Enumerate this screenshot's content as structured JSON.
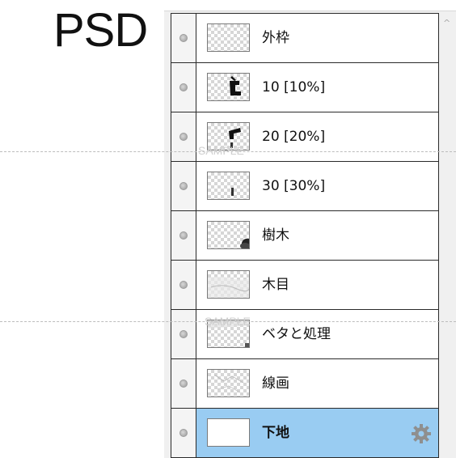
{
  "header": {
    "label": "PSD"
  },
  "watermark": {
    "text": "SAMPLE"
  },
  "colors": {
    "selected_row": "#99ccf2",
    "border": "#2a2a2a",
    "panel_bg": "#f0f0f0"
  },
  "layers": [
    {
      "name": "外枠",
      "visible_icon": "visibility-dot-icon",
      "thumb": "empty"
    },
    {
      "name": "10 [10%]",
      "visible_icon": "visibility-dot-icon",
      "thumb": "shape-10"
    },
    {
      "name": "20 [20%]",
      "visible_icon": "visibility-dot-icon",
      "thumb": "shape-20"
    },
    {
      "name": "30 [30%]",
      "visible_icon": "visibility-dot-icon",
      "thumb": "shape-30"
    },
    {
      "name": "樹木",
      "visible_icon": "visibility-dot-icon",
      "thumb": "tree"
    },
    {
      "name": "木目",
      "visible_icon": "visibility-dot-icon",
      "thumb": "woodgrain"
    },
    {
      "name": "ベタと処理",
      "visible_icon": "visibility-dot-icon",
      "thumb": "fill"
    },
    {
      "name": "線画",
      "visible_icon": "visibility-dot-icon",
      "thumb": "lineart"
    },
    {
      "name": "下地",
      "visible_icon": "visibility-dot-icon",
      "thumb": "white",
      "selected": true,
      "settings_icon": "gear-icon"
    }
  ],
  "scrollbar": {
    "up_icon": "chevron-up-icon"
  }
}
